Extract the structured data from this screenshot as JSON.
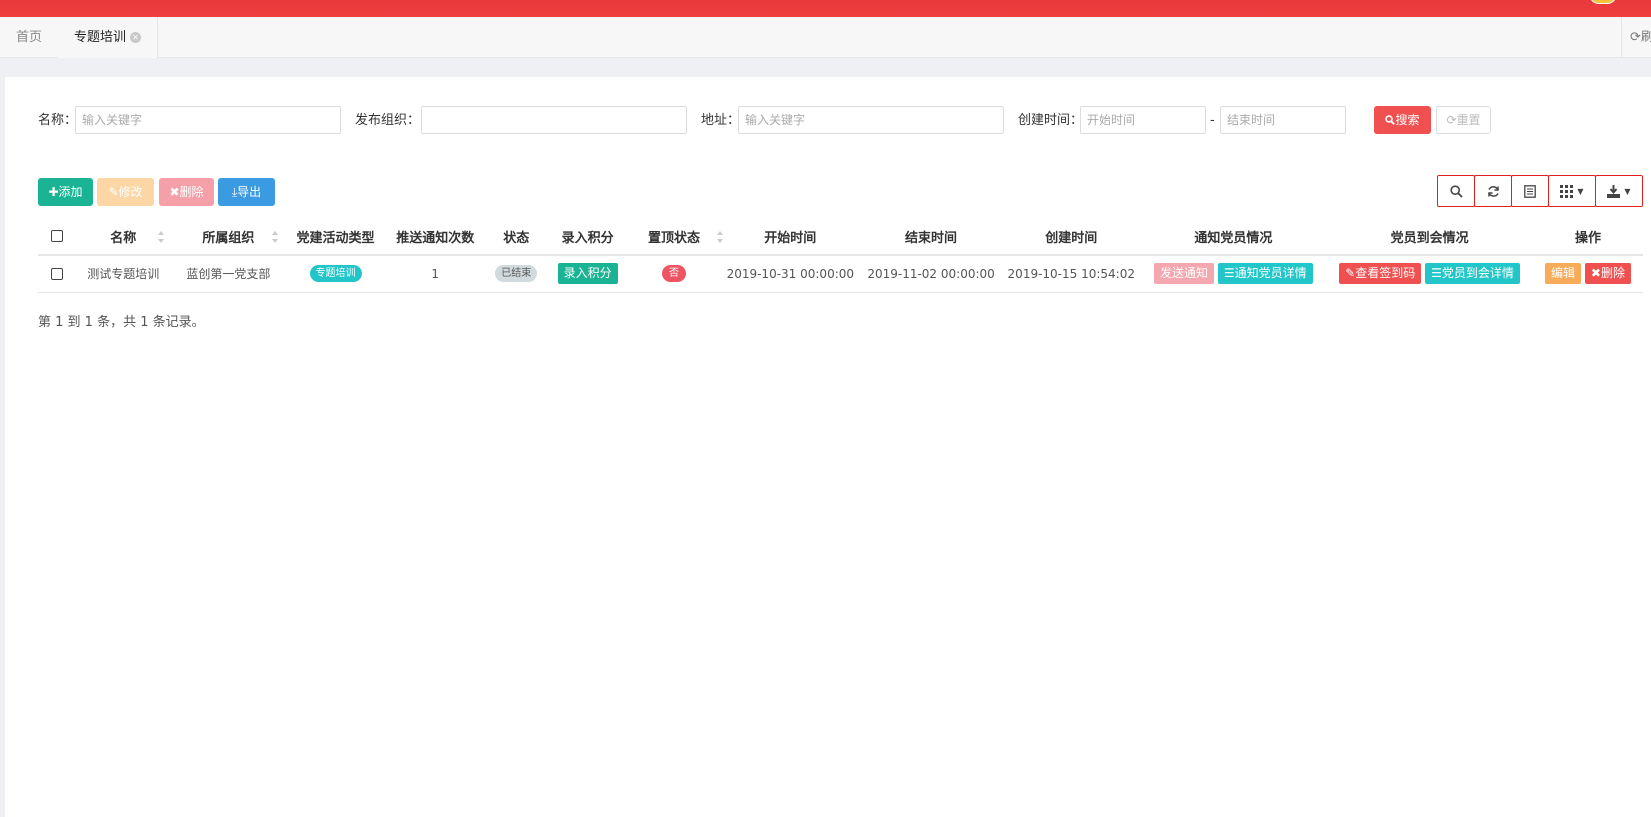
{
  "tabs": {
    "home": "首页",
    "current": "专题培训",
    "refresh": "刷"
  },
  "search": {
    "name_label": "名称：",
    "name_placeholder": "输入关键字",
    "org_label": "发布组织：",
    "org_value": "",
    "address_label": "地址：",
    "address_placeholder": "输入关键字",
    "created_label": "创建时间：",
    "start_placeholder": "开始时间",
    "range_sep": "-",
    "end_placeholder": "结束时间",
    "search_btn": "搜索",
    "reset_btn": "重置"
  },
  "toolbar": {
    "add": "添加",
    "edit": "修改",
    "delete": "删除",
    "export": "导出"
  },
  "table": {
    "headers": [
      "名称",
      "所属组织",
      "党建活动类型",
      "推送通知次数",
      "状态",
      "录入积分",
      "置顶状态",
      "开始时间",
      "结束时间",
      "创建时间",
      "通知党员情况",
      "党员到会情况",
      "操作"
    ],
    "rows": [
      {
        "name": "测试专题培训",
        "org": "蓝创第一党支部",
        "type": "专题培训",
        "push_count": "1",
        "status": "已结束",
        "score_btn": "录入积分",
        "top": "否",
        "start": "2019-10-31 00:00:00",
        "end": "2019-11-02 00:00:00",
        "created": "2019-10-15 10:54:02",
        "notify_btn": "发送通知",
        "notify_detail_btn": "通知党员详情",
        "sign_code_btn": "查看签到码",
        "attend_detail_btn": "党员到会详情",
        "edit_btn": "编辑",
        "del_btn": "删除"
      }
    ]
  },
  "pager": "第 1 到 1 条，共 1 条记录。"
}
